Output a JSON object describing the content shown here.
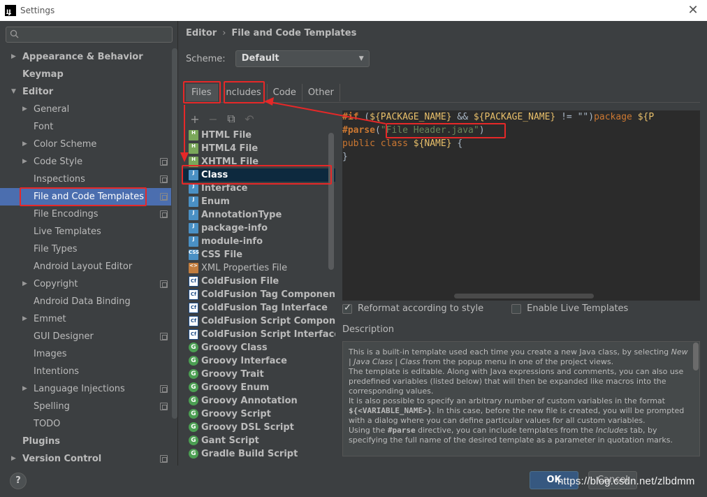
{
  "window": {
    "title": "Settings",
    "close_glyph": "✕"
  },
  "sidebar": {
    "search_placeholder": "",
    "items": [
      {
        "label": "Appearance & Behavior",
        "bold": true,
        "arrow": "right",
        "indent": 0
      },
      {
        "label": "Keymap",
        "bold": true,
        "indent": 0
      },
      {
        "label": "Editor",
        "bold": true,
        "arrow": "down",
        "indent": 0
      },
      {
        "label": "General",
        "arrow": "right",
        "indent": 1
      },
      {
        "label": "Font",
        "indent": 1
      },
      {
        "label": "Color Scheme",
        "arrow": "right",
        "indent": 1
      },
      {
        "label": "Code Style",
        "arrow": "right",
        "indent": 1,
        "cfg": true
      },
      {
        "label": "Inspections",
        "indent": 1,
        "cfg": true
      },
      {
        "label": "File and Code Templates",
        "indent": 1,
        "cfg": true,
        "selected": true
      },
      {
        "label": "File Encodings",
        "indent": 1,
        "cfg": true
      },
      {
        "label": "Live Templates",
        "indent": 1
      },
      {
        "label": "File Types",
        "indent": 1
      },
      {
        "label": "Android Layout Editor",
        "indent": 1
      },
      {
        "label": "Copyright",
        "arrow": "right",
        "indent": 1,
        "cfg": true
      },
      {
        "label": "Android Data Binding",
        "indent": 1
      },
      {
        "label": "Emmet",
        "arrow": "right",
        "indent": 1
      },
      {
        "label": "GUI Designer",
        "indent": 1,
        "cfg": true
      },
      {
        "label": "Images",
        "indent": 1
      },
      {
        "label": "Intentions",
        "indent": 1
      },
      {
        "label": "Language Injections",
        "arrow": "right",
        "indent": 1,
        "cfg": true
      },
      {
        "label": "Spelling",
        "indent": 1,
        "cfg": true
      },
      {
        "label": "TODO",
        "indent": 1
      },
      {
        "label": "Plugins",
        "bold": true,
        "indent": 0
      },
      {
        "label": "Version Control",
        "bold": true,
        "arrow": "right",
        "indent": 0,
        "cfg": true
      }
    ]
  },
  "main": {
    "breadcrumb": {
      "parent": "Editor",
      "separator": "›",
      "current": "File and Code Templates"
    },
    "scheme": {
      "label": "Scheme:",
      "value": "Default"
    },
    "tabs": [
      "Files",
      "Includes",
      "Code",
      "Other"
    ],
    "active_tab": "Files",
    "toolbar": [
      "+",
      "−",
      "⧉",
      "↶"
    ],
    "files": [
      {
        "label": "HTML File",
        "icon": "html",
        "icon_text": "H"
      },
      {
        "label": "HTML4 File",
        "icon": "html",
        "icon_text": "H"
      },
      {
        "label": "XHTML File",
        "icon": "html",
        "icon_text": "H"
      },
      {
        "label": "Class",
        "icon": "java",
        "icon_text": "J",
        "selected": true
      },
      {
        "label": "Interface",
        "icon": "java",
        "icon_text": "J"
      },
      {
        "label": "Enum",
        "icon": "java",
        "icon_text": "J"
      },
      {
        "label": "AnnotationType",
        "icon": "java",
        "icon_text": "J"
      },
      {
        "label": "package-info",
        "icon": "java",
        "icon_text": "J"
      },
      {
        "label": "module-info",
        "icon": "java",
        "icon_text": "J"
      },
      {
        "label": "CSS File",
        "icon": "css",
        "icon_text": "CSS"
      },
      {
        "label": "XML Properties File",
        "icon": "xml",
        "icon_text": "<>",
        "normal": true
      },
      {
        "label": "ColdFusion File",
        "icon": "cf",
        "icon_text": "Cf"
      },
      {
        "label": "ColdFusion Tag Component",
        "icon": "cf",
        "icon_text": "Cf"
      },
      {
        "label": "ColdFusion Tag Interface",
        "icon": "cf",
        "icon_text": "Cf"
      },
      {
        "label": "ColdFusion Script Component",
        "icon": "cf",
        "icon_text": "Cf"
      },
      {
        "label": "ColdFusion Script Interface",
        "icon": "cf",
        "icon_text": "Cf"
      },
      {
        "label": "Groovy Class",
        "icon": "groovy",
        "icon_text": "G"
      },
      {
        "label": "Groovy Interface",
        "icon": "groovy",
        "icon_text": "G"
      },
      {
        "label": "Groovy Trait",
        "icon": "groovy",
        "icon_text": "G"
      },
      {
        "label": "Groovy Enum",
        "icon": "groovy",
        "icon_text": "G"
      },
      {
        "label": "Groovy Annotation",
        "icon": "groovy",
        "icon_text": "G"
      },
      {
        "label": "Groovy Script",
        "icon": "groovy",
        "icon_text": "G"
      },
      {
        "label": "Groovy DSL Script",
        "icon": "groovy",
        "icon_text": "G"
      },
      {
        "label": "Gant Script",
        "icon": "groovy",
        "icon_text": "G"
      },
      {
        "label": "Gradle Build Script",
        "icon": "groovy",
        "icon_text": "G"
      }
    ],
    "editor": {
      "lines": [
        [
          {
            "t": "#if",
            "c": "dir"
          },
          {
            "t": " (",
            "c": ""
          },
          {
            "t": "${PACKAGE_NAME}",
            "c": "var"
          },
          {
            "t": " && ",
            "c": ""
          },
          {
            "t": "${PACKAGE_NAME}",
            "c": "var"
          },
          {
            "t": " != \"\")",
            "c": ""
          },
          {
            "t": "package ",
            "c": "kw"
          },
          {
            "t": "${P",
            "c": "var"
          }
        ],
        [
          {
            "t": "#parse",
            "c": "dir"
          },
          {
            "t": "(",
            "c": ""
          },
          {
            "t": "\"File Header.java\"",
            "c": "str"
          },
          {
            "t": ")",
            "c": ""
          }
        ],
        [
          {
            "t": "public class ",
            "c": "kw"
          },
          {
            "t": "${NAME}",
            "c": "var"
          },
          {
            "t": " {",
            "c": ""
          }
        ],
        [
          {
            "t": "}",
            "c": ""
          }
        ]
      ]
    },
    "options": {
      "reformat": {
        "label": "Reformat according to style",
        "checked": true
      },
      "live_templates": {
        "label": "Enable Live Templates",
        "checked": false
      }
    },
    "description": {
      "label": "Description",
      "html": "This is a built-in template used each time you create a new Java class, by selecting <i>New | Java Class | Class</i> from the popup menu in one of the project views.<br>The template is editable. Along with Java expressions and comments, you can also use predefined variables (listed below) that will then be expanded like macros into the corresponding values.<br>It is also possible to specify an arbitrary number of custom variables in the format <b>${&lt;VARIABLE_NAME&gt;}</b>. In this case, before the new file is created, you will be prompted with a dialog where you can define particular values for all custom variables.<br>Using the <b>#parse</b> directive, you can include templates from the <i>Includes</i> tab, by specifying the full name of the desired template as a parameter in quotation marks."
    }
  },
  "bottom": {
    "help_label": "?",
    "ok_label": "OK",
    "cancel_label": "Cancel",
    "watermark": "https://blog.csdn.net/zlbdmm"
  },
  "colors": {
    "accent_selected": "#4b6eaf",
    "annotation_red": "#e62828",
    "ok_button": "#365880"
  }
}
